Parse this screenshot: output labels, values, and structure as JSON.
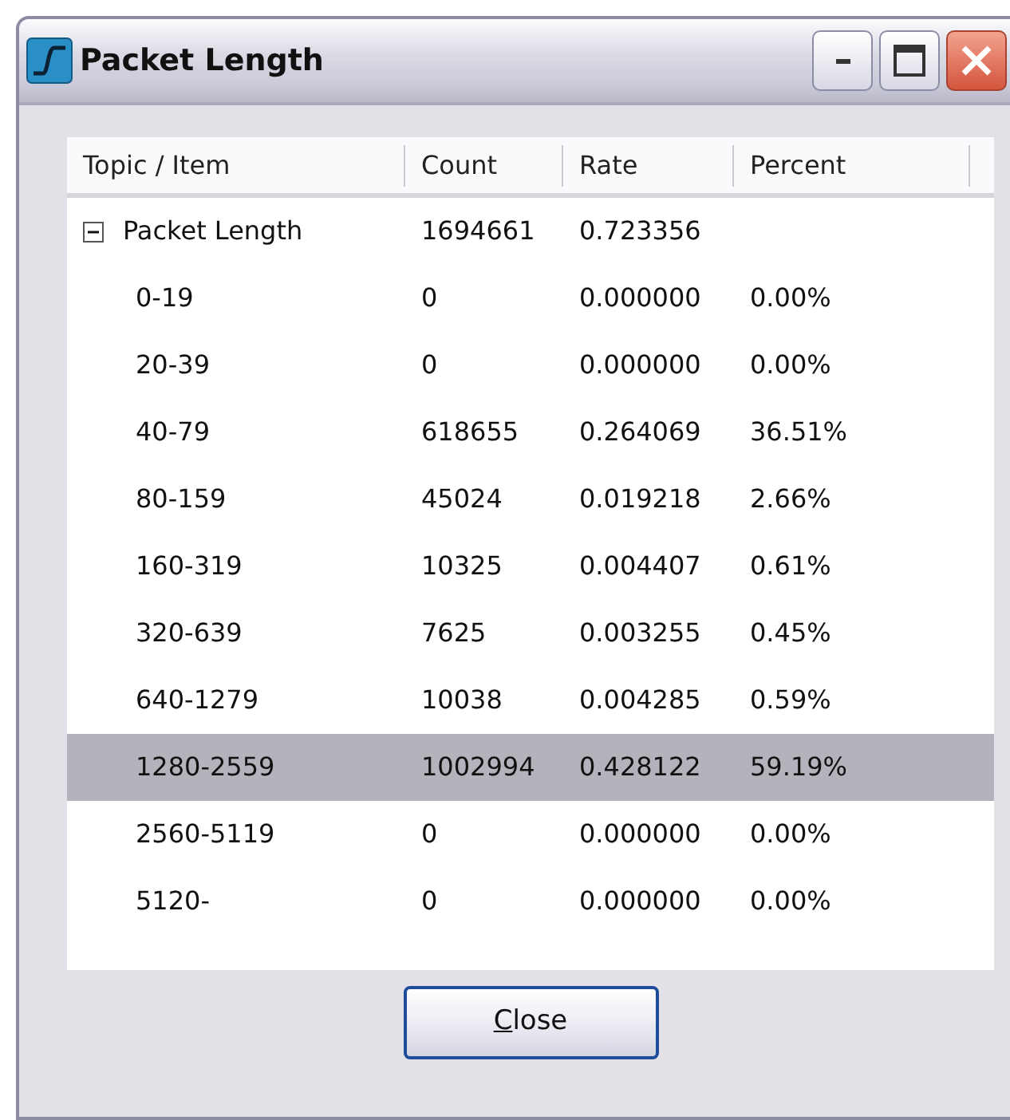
{
  "window": {
    "title": "Packet Length"
  },
  "table": {
    "columns": [
      "Topic / Item",
      "Count",
      "Rate",
      "Percent"
    ],
    "rows": [
      {
        "cells": [
          "Packet Length",
          "1694661",
          "0.723356",
          ""
        ],
        "expanded": true,
        "selected": false,
        "children": [
          {
            "cells": [
              "0-19",
              "0",
              "0.000000",
              "0.00%"
            ],
            "selected": false
          },
          {
            "cells": [
              "20-39",
              "0",
              "0.000000",
              "0.00%"
            ],
            "selected": false
          },
          {
            "cells": [
              "40-79",
              "618655",
              "0.264069",
              "36.51%"
            ],
            "selected": false
          },
          {
            "cells": [
              "80-159",
              "45024",
              "0.019218",
              "2.66%"
            ],
            "selected": false
          },
          {
            "cells": [
              "160-319",
              "10325",
              "0.004407",
              "0.61%"
            ],
            "selected": false
          },
          {
            "cells": [
              "320-639",
              "7625",
              "0.003255",
              "0.45%"
            ],
            "selected": false
          },
          {
            "cells": [
              "640-1279",
              "10038",
              "0.004285",
              "0.59%"
            ],
            "selected": false
          },
          {
            "cells": [
              "1280-2559",
              "1002994",
              "0.428122",
              "59.19%"
            ],
            "selected": true
          },
          {
            "cells": [
              "2560-5119",
              "0",
              "0.000000",
              "0.00%"
            ],
            "selected": false
          },
          {
            "cells": [
              "5120-",
              "0",
              "0.000000",
              "0.00%"
            ],
            "selected": false
          }
        ]
      }
    ]
  },
  "buttons": [
    {
      "label": "Close",
      "mnemonic": true
    }
  ]
}
